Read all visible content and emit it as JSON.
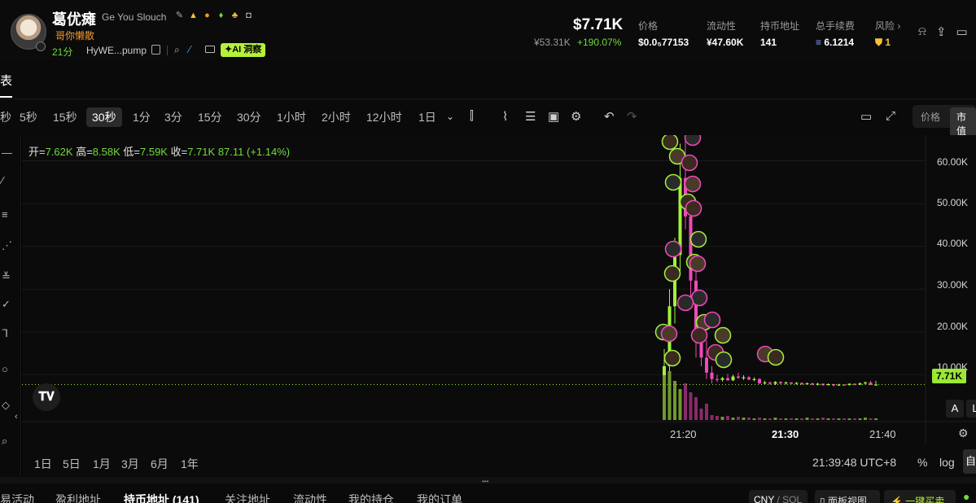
{
  "header": {
    "token_name": "葛优瘫",
    "token_en": "Ge You Slouch",
    "token_sub": "哥你懒散",
    "age": "21分",
    "address": "HyWE...pump",
    "ai_badge": "✦AI 洞察",
    "market_cap": "$7.71K",
    "market_cap_cny": "¥53.31K",
    "change_pct": "+190.07%",
    "stats": {
      "price_label": "价格",
      "price_value": "$0.0₅77153",
      "liquidity_label": "流动性",
      "liquidity_value": "¥47.60K",
      "holders_label": "持币地址",
      "holders_value": "141",
      "fees_label": "总手续费",
      "fees_value": "6.1214",
      "risk_label": "风险 ›",
      "risk_value": "1"
    }
  },
  "tabstrip": {
    "active_tab": "表"
  },
  "toolbar": {
    "intervals": [
      "秒",
      "5秒",
      "15秒",
      "30秒",
      "1分",
      "3分",
      "15分",
      "30分",
      "1小时",
      "2小时",
      "12小时",
      "1日"
    ],
    "active_interval": "30秒",
    "price_toggle": {
      "option_price": "价格",
      "option_mcap": "市值"
    }
  },
  "ohlc": {
    "open_label": "开=",
    "open": "7.62K",
    "high_label": "高=",
    "high": "8.58K",
    "low_label": "低=",
    "low": "7.59K",
    "close_label": "收=",
    "close": "7.71K",
    "change": "87.11 (+1.14%)"
  },
  "chart_data": {
    "type": "candlestick",
    "y_axis_labels": [
      "60.00K",
      "50.00K",
      "40.00K",
      "30.00K",
      "20.00K",
      "10.00K"
    ],
    "ylim": [
      0,
      66000
    ],
    "current_price_label": "7.71K",
    "x_axis_labels": [
      "21:20",
      "21:30",
      "21:40"
    ],
    "candles": [
      {
        "t": "21:19:30",
        "o": 1500,
        "h": 16000,
        "l": 1000,
        "c": 12000,
        "up": true
      },
      {
        "t": "21:20:00",
        "o": 12000,
        "h": 30000,
        "l": 9000,
        "c": 26000,
        "up": true
      },
      {
        "t": "21:20:30",
        "o": 26000,
        "h": 42000,
        "l": 22000,
        "c": 38000,
        "up": true
      },
      {
        "t": "21:21:00",
        "o": 38000,
        "h": 64000,
        "l": 34000,
        "c": 56000,
        "up": true
      },
      {
        "t": "21:21:30",
        "o": 56000,
        "h": 66000,
        "l": 44000,
        "c": 47000,
        "up": false
      },
      {
        "t": "21:22:00",
        "o": 47000,
        "h": 50000,
        "l": 28000,
        "c": 32000,
        "up": false
      },
      {
        "t": "21:22:30",
        "o": 32000,
        "h": 36000,
        "l": 14000,
        "c": 19000,
        "up": false
      },
      {
        "t": "21:23:00",
        "o": 19000,
        "h": 24000,
        "l": 12000,
        "c": 14000,
        "up": false
      },
      {
        "t": "21:23:30",
        "o": 14000,
        "h": 18000,
        "l": 9000,
        "c": 10500,
        "up": false
      },
      {
        "t": "21:24:00",
        "o": 10500,
        "h": 12000,
        "l": 8000,
        "c": 9000,
        "up": false
      },
      {
        "t": "21:24:30",
        "o": 9000,
        "h": 10000,
        "l": 8300,
        "c": 8800,
        "up": false
      },
      {
        "t": "21:25:00",
        "o": 8800,
        "h": 9500,
        "l": 8400,
        "c": 9200,
        "up": true
      },
      {
        "t": "21:25:30",
        "o": 9200,
        "h": 10200,
        "l": 8600,
        "c": 8700,
        "up": false
      },
      {
        "t": "21:26:00",
        "o": 8700,
        "h": 10000,
        "l": 8500,
        "c": 9600,
        "up": true
      },
      {
        "t": "21:26:30",
        "o": 9600,
        "h": 10500,
        "l": 9000,
        "c": 9300,
        "up": false
      },
      {
        "t": "21:27:00",
        "o": 9300,
        "h": 9900,
        "l": 8800,
        "c": 9400,
        "up": true
      },
      {
        "t": "21:27:30",
        "o": 9400,
        "h": 9700,
        "l": 8700,
        "c": 8900,
        "up": false
      },
      {
        "t": "21:28:00",
        "o": 8900,
        "h": 9400,
        "l": 8500,
        "c": 9000,
        "up": true
      },
      {
        "t": "21:28:30",
        "o": 9000,
        "h": 9200,
        "l": 7800,
        "c": 8000,
        "up": false
      },
      {
        "t": "21:29:00",
        "o": 8000,
        "h": 8600,
        "l": 7600,
        "c": 8200,
        "up": true
      },
      {
        "t": "21:29:30",
        "o": 8200,
        "h": 8400,
        "l": 7700,
        "c": 7900,
        "up": false
      },
      {
        "t": "21:30:00",
        "o": 7900,
        "h": 8500,
        "l": 7600,
        "c": 8300,
        "up": true
      },
      {
        "t": "21:30:30",
        "o": 8300,
        "h": 8500,
        "l": 7800,
        "c": 8000,
        "up": false
      },
      {
        "t": "21:31:00",
        "o": 8000,
        "h": 8400,
        "l": 7700,
        "c": 8200,
        "up": true
      },
      {
        "t": "21:31:30",
        "o": 8200,
        "h": 8300,
        "l": 7800,
        "c": 7900,
        "up": false
      },
      {
        "t": "21:32:00",
        "o": 7900,
        "h": 8300,
        "l": 7700,
        "c": 8100,
        "up": true
      },
      {
        "t": "21:32:30",
        "o": 8100,
        "h": 8200,
        "l": 7600,
        "c": 7800,
        "up": false
      },
      {
        "t": "21:33:00",
        "o": 7800,
        "h": 8200,
        "l": 7600,
        "c": 8000,
        "up": true
      },
      {
        "t": "21:33:30",
        "o": 8000,
        "h": 8100,
        "l": 7500,
        "c": 7700,
        "up": false
      },
      {
        "t": "21:34:00",
        "o": 7700,
        "h": 8100,
        "l": 7500,
        "c": 7900,
        "up": true
      },
      {
        "t": "21:34:30",
        "o": 7900,
        "h": 8000,
        "l": 7400,
        "c": 7600,
        "up": false
      },
      {
        "t": "21:35:00",
        "o": 7600,
        "h": 8000,
        "l": 7500,
        "c": 7800,
        "up": true
      },
      {
        "t": "21:35:30",
        "o": 7800,
        "h": 7900,
        "l": 7300,
        "c": 7500,
        "up": false
      },
      {
        "t": "21:36:00",
        "o": 7500,
        "h": 7900,
        "l": 7400,
        "c": 7700,
        "up": true
      },
      {
        "t": "21:36:30",
        "o": 7700,
        "h": 7800,
        "l": 7400,
        "c": 7600,
        "up": false
      },
      {
        "t": "21:37:00",
        "o": 7600,
        "h": 8000,
        "l": 7500,
        "c": 7900,
        "up": true
      },
      {
        "t": "21:37:30",
        "o": 7900,
        "h": 8000,
        "l": 7500,
        "c": 7700,
        "up": false
      },
      {
        "t": "21:38:00",
        "o": 7700,
        "h": 8200,
        "l": 7600,
        "c": 8000,
        "up": true
      },
      {
        "t": "21:38:30",
        "o": 8000,
        "h": 8400,
        "l": 7700,
        "c": 8200,
        "up": true
      },
      {
        "t": "21:39:00",
        "o": 8200,
        "h": 8580,
        "l": 7600,
        "c": 7620,
        "up": false
      },
      {
        "t": "21:39:30",
        "o": 7620,
        "h": 8580,
        "l": 7590,
        "c": 7710,
        "up": true
      }
    ],
    "volumes": [
      55,
      60,
      48,
      38,
      45,
      34,
      28,
      14,
      20,
      6,
      5,
      4,
      5,
      3,
      4,
      3,
      3,
      2,
      3,
      2,
      2,
      3,
      2,
      2,
      2,
      2,
      2,
      3,
      2,
      2,
      3,
      2,
      2,
      2,
      2,
      2,
      2,
      2,
      3,
      2,
      2
    ],
    "trade_markers": 26,
    "colors": {
      "up": "#a3f03c",
      "down": "#f04ab8",
      "vol_up": "#6e9a2a",
      "vol_down": "#8a2a6a"
    }
  },
  "chart_controls": {
    "btn_a": "A",
    "btn_l": "L"
  },
  "rangebar": {
    "ranges": [
      "1日",
      "5日",
      "1月",
      "3月",
      "6月",
      "1年"
    ],
    "time": "21:39:48 UTC+8",
    "pct": "%",
    "log": "log",
    "auto": "自"
  },
  "bottom": {
    "tabs": [
      "易活动",
      "盈利地址",
      "持币地址 (141)",
      "关注地址",
      "流动性",
      "我的持仓",
      "我的订单"
    ],
    "active_tab": "持币地址 (141)",
    "currency_main": "CNY",
    "currency_alt": "/ SOL",
    "panel_view": "面板视图",
    "quick_buy": "⚡ 一键买卖"
  }
}
